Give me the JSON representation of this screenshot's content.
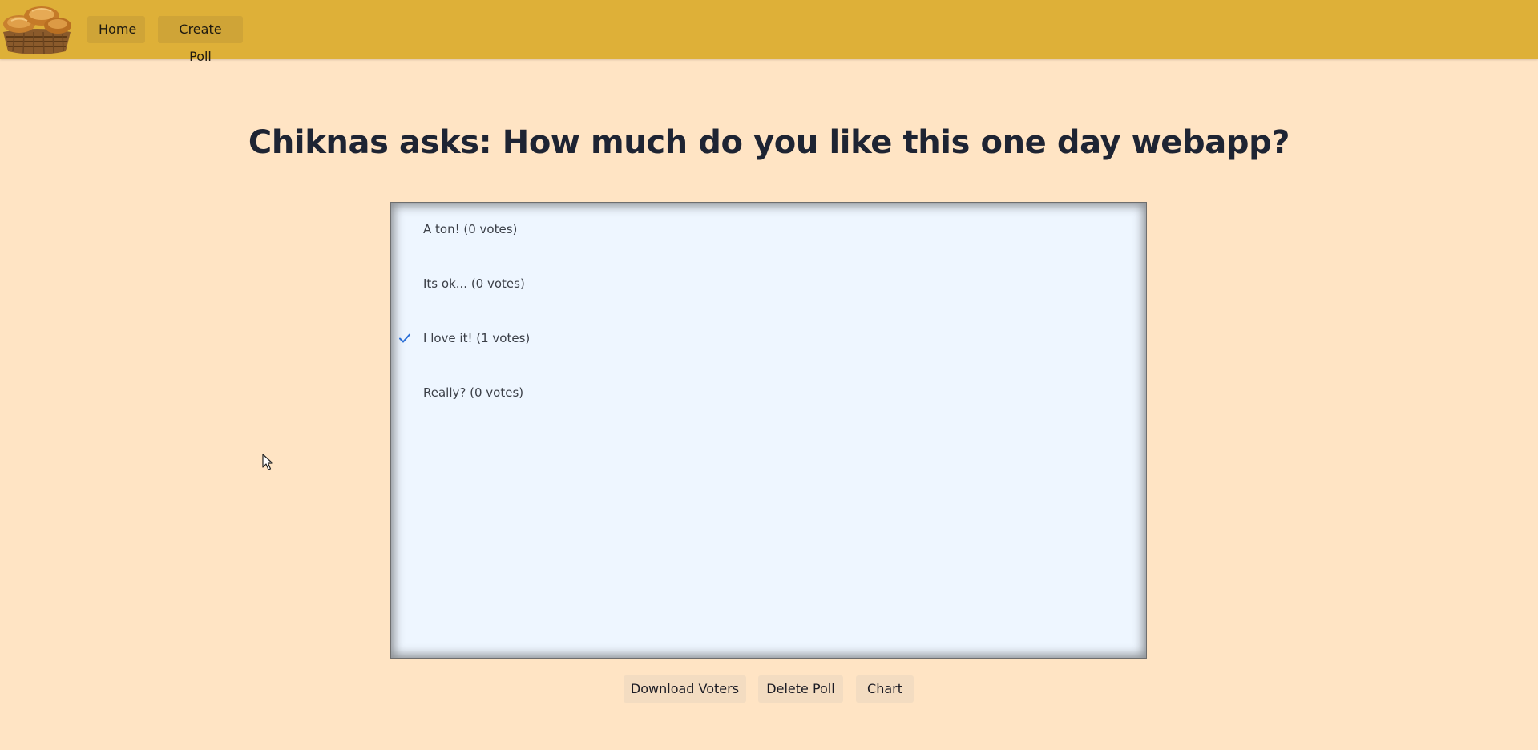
{
  "nav": {
    "logo_icon": "croissant-basket-logo",
    "home_label": "Home",
    "create_poll_label": "Create Poll"
  },
  "poll": {
    "title": "Chiknas asks: How much do you like this one day webapp?",
    "options": [
      {
        "label": "A ton! (0 votes)",
        "selected": false
      },
      {
        "label": "Its ok... (0 votes)",
        "selected": false
      },
      {
        "label": "I love it! (1 votes)",
        "selected": true
      },
      {
        "label": "Really? (0 votes)",
        "selected": false
      }
    ]
  },
  "actions": {
    "download_label": "Download Voters",
    "delete_label": "Delete Poll",
    "chart_label": "Chart"
  },
  "colors": {
    "topbar": "#deb038",
    "page_background": "#ffe4c4",
    "options_background": "#eef6ff",
    "check": "#2b6fd6",
    "title_text": "#1e2433"
  }
}
